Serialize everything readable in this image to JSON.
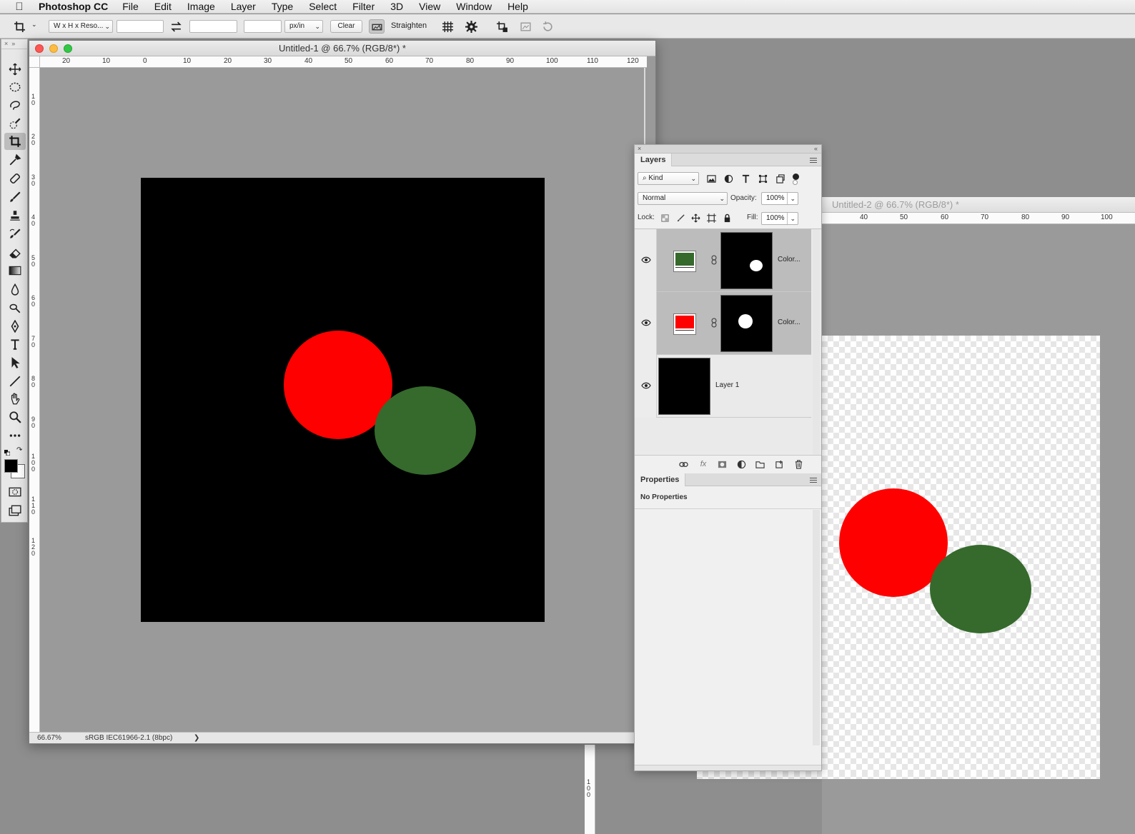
{
  "menubar": {
    "app_name": "Photoshop CC",
    "items": [
      "File",
      "Edit",
      "Image",
      "Layer",
      "Type",
      "Select",
      "Filter",
      "3D",
      "View",
      "Window",
      "Help"
    ]
  },
  "options_bar": {
    "ratio_preset": "W x H x Reso...",
    "width_value": "",
    "height_value": "",
    "resolution_value": "",
    "resolution_unit": "px/in",
    "clear_label": "Clear",
    "straighten_label": "Straighten"
  },
  "document1": {
    "title": "Untitled-1 @ 66.7% (RGB/8*) *",
    "zoom": "66.67%",
    "profile": "sRGB IEC61966-2.1 (8bpc)",
    "status_arrow": "❯",
    "hruler_labels": [
      "20",
      "10",
      "0",
      "10",
      "20",
      "30",
      "40",
      "50",
      "60",
      "70",
      "80",
      "90",
      "100",
      "110",
      "120"
    ],
    "vruler_labels": [
      "1\n0",
      "2\n0",
      "3\n0",
      "4\n0",
      "5\n0",
      "6\n0",
      "7\n0",
      "8\n0",
      "9\n0",
      "1\n0\n0",
      "1\n1\n0",
      "1\n2\n0"
    ],
    "canvas_background": "#000000",
    "shapes": [
      {
        "name": "red-circle",
        "color": "#ff0000"
      },
      {
        "name": "green-ellipse",
        "color": "#356a2c"
      }
    ]
  },
  "document2": {
    "title": "Untitled-2 @ 66.7% (RGB/8*) *",
    "hruler_labels": [
      "40",
      "50",
      "60",
      "70",
      "80",
      "90",
      "100"
    ],
    "vruler_labels": [
      "1\n0\n0"
    ],
    "shapes": [
      {
        "name": "red-circle",
        "color": "#ff0000"
      },
      {
        "name": "green-ellipse",
        "color": "#356a2c"
      }
    ]
  },
  "layers_panel": {
    "tab": "Layers",
    "filter_kind": "Kind",
    "blend_mode": "Normal",
    "opacity_label": "Opacity:",
    "opacity_value": "100%",
    "lock_label": "Lock:",
    "fill_label": "Fill:",
    "fill_value": "100%",
    "layers": [
      {
        "name": "Color...",
        "type": "color-fill",
        "swatch": "#356a2c",
        "selected": true
      },
      {
        "name": "Color...",
        "type": "color-fill",
        "swatch": "#ff0000",
        "selected": true
      },
      {
        "name": "Layer 1",
        "type": "pixel",
        "swatch": "#000000",
        "selected": false
      }
    ]
  },
  "properties_panel": {
    "tab": "Properties",
    "message": "No Properties"
  }
}
